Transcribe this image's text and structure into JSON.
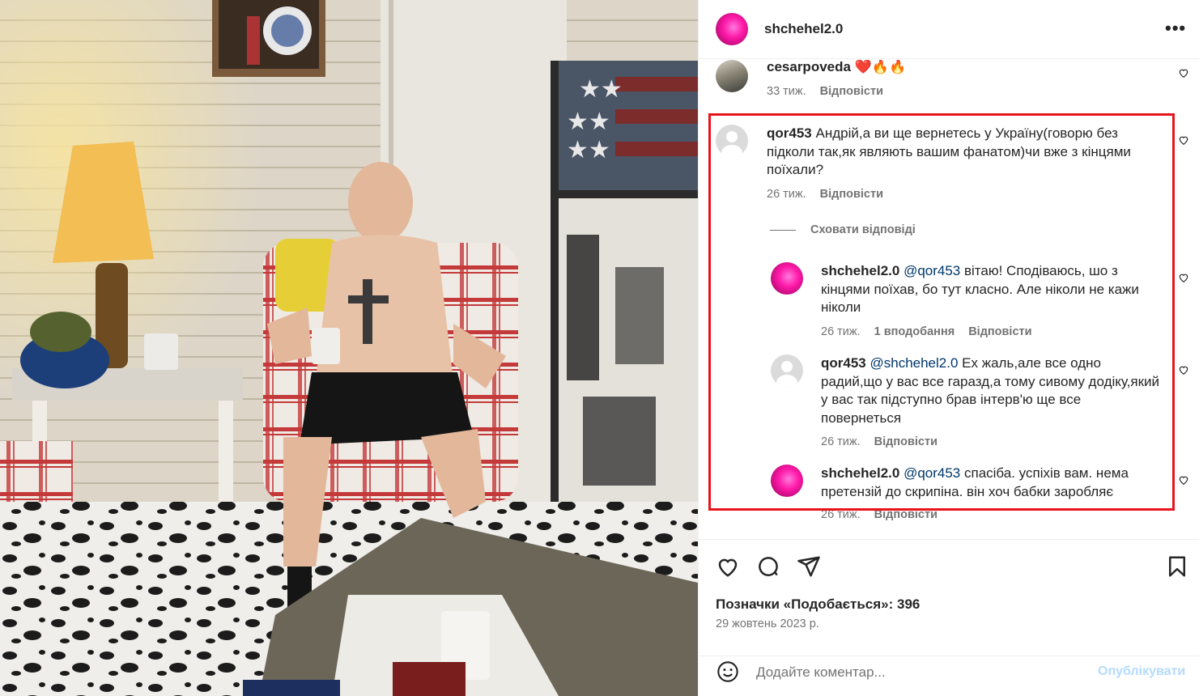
{
  "post": {
    "username": "shchehel2.0",
    "more_icon": "more-horizontal-icon"
  },
  "comments": [
    {
      "username": "cesarpoveda",
      "text": "❤️🔥🔥",
      "time": "33 тиж.",
      "reply": "Відповісти"
    },
    {
      "username": "qor453",
      "text": "Андрій,а ви ще вернетесь у Україну(говорю без підколи так,як являють вашим фанатом)чи вже з кінцями поїхали?",
      "time": "26 тиж.",
      "reply": "Відповісти"
    }
  ],
  "hide_replies": "Сховати відповіді",
  "replies": [
    {
      "username": "shchehel2.0",
      "mention": "@qor453",
      "text": "вітаю! Сподіваюсь, шо з кінцями поїхав, бо тут класно. Але ніколи не кажи ніколи",
      "time": "26 тиж.",
      "likes": "1 вподобання",
      "reply": "Відповісти"
    },
    {
      "username": "qor453",
      "mention": "@shchehel2.0",
      "text": "Ех жаль,але все одно радий,що у вас все гаразд,а тому сивому додіку,який у вас так підступно брав інтерв'ю ще все повернеться",
      "time": "26 тиж.",
      "reply": "Відповісти"
    },
    {
      "username": "shchehel2.0",
      "mention": "@qor453",
      "text": "спасіба. успіхів вам. нема претензій до скрипіна. він хоч бабки заробляє",
      "time": "26 тиж.",
      "reply": "Відповісти"
    }
  ],
  "footer": {
    "likes": "Позначки «Подобається»: 396",
    "date": "29 жовтень 2023 р.",
    "comment_placeholder": "Додайте коментар...",
    "post_button": "Опублікувати"
  },
  "colors": {
    "highlight_box": "#e8141b",
    "mention": "#00376b",
    "post_button_disabled": "#b3dbff"
  }
}
